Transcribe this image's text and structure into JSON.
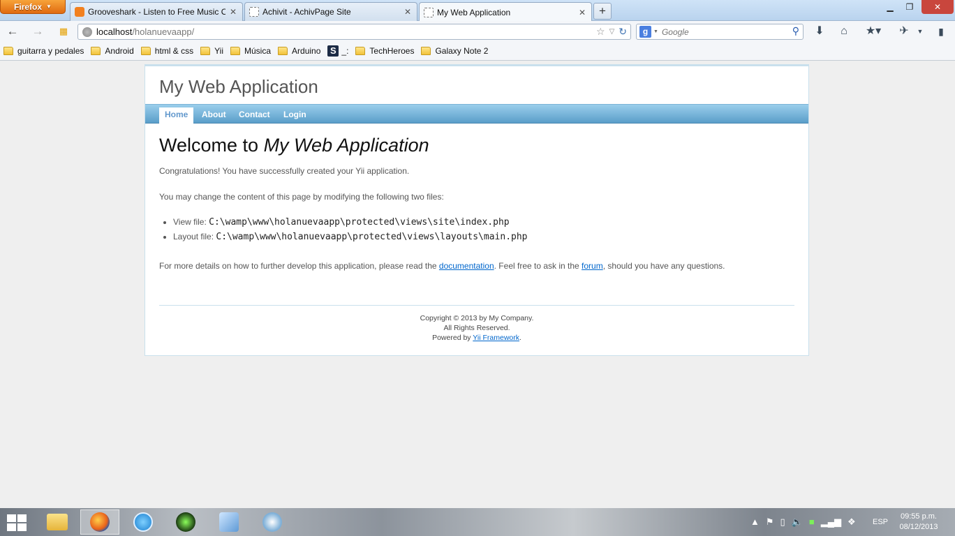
{
  "browser": {
    "menu_button": "Firefox",
    "tabs": [
      {
        "title": "Grooveshark - Listen to Free Music O...",
        "icon": "grooveshark-icon",
        "active": false
      },
      {
        "title": "Achivit - AchivPage Site",
        "icon": "blank-page-icon",
        "active": false
      },
      {
        "title": "My Web Application",
        "icon": "blank-page-icon",
        "active": true
      }
    ],
    "new_tab": "+",
    "url_host": "localhost",
    "url_path": "/holanuevaapp/",
    "search_engine": "g",
    "search_placeholder": "Google",
    "bookmarks": [
      {
        "label": "guitarra y pedales",
        "icon": "folder-icon"
      },
      {
        "label": "Android",
        "icon": "folder-icon"
      },
      {
        "label": "html & css",
        "icon": "folder-icon"
      },
      {
        "label": "Yii",
        "icon": "folder-icon"
      },
      {
        "label": "Música",
        "icon": "folder-icon"
      },
      {
        "label": "Arduino",
        "icon": "folder-icon"
      },
      {
        "label": "_:",
        "icon": "s-logo-icon"
      },
      {
        "label": "TechHeroes",
        "icon": "folder-icon"
      },
      {
        "label": "Galaxy Note 2",
        "icon": "folder-icon"
      }
    ]
  },
  "site": {
    "logo": "My Web Application",
    "menu": [
      "Home",
      "About",
      "Contact",
      "Login"
    ],
    "heading_prefix": "Welcome to ",
    "heading_app": "My Web Application",
    "congrats": "Congratulations! You have successfully created your Yii application.",
    "change_intro": "You may change the content of this page by modifying the following two files:",
    "files": [
      {
        "label": "View file: ",
        "path": "C:\\wamp\\www\\holanuevaapp\\protected\\views\\site\\index.php"
      },
      {
        "label": "Layout file: ",
        "path": "C:\\wamp\\www\\holanuevaapp\\protected\\views\\layouts\\main.php"
      }
    ],
    "details_1": "For more details on how to further develop this application, please read the ",
    "documentation_link": "documentation",
    "details_2": ". Feel free to ask in the ",
    "forum_link": "forum",
    "details_3": ", should you have any questions.",
    "footer_copyright": "Copyright © 2013 by My Company.",
    "footer_rights": "All Rights Reserved.",
    "footer_powered": "Powered by ",
    "footer_framework_link": "Yii Framework",
    "footer_period": "."
  },
  "taskbar": {
    "language": "ESP",
    "time": "09:55 p.m.",
    "date": "08/12/2013"
  },
  "colors": {
    "menu_active_text": "#6399cd",
    "link": "#0066cc",
    "firefox_orange": "#e06a10"
  }
}
